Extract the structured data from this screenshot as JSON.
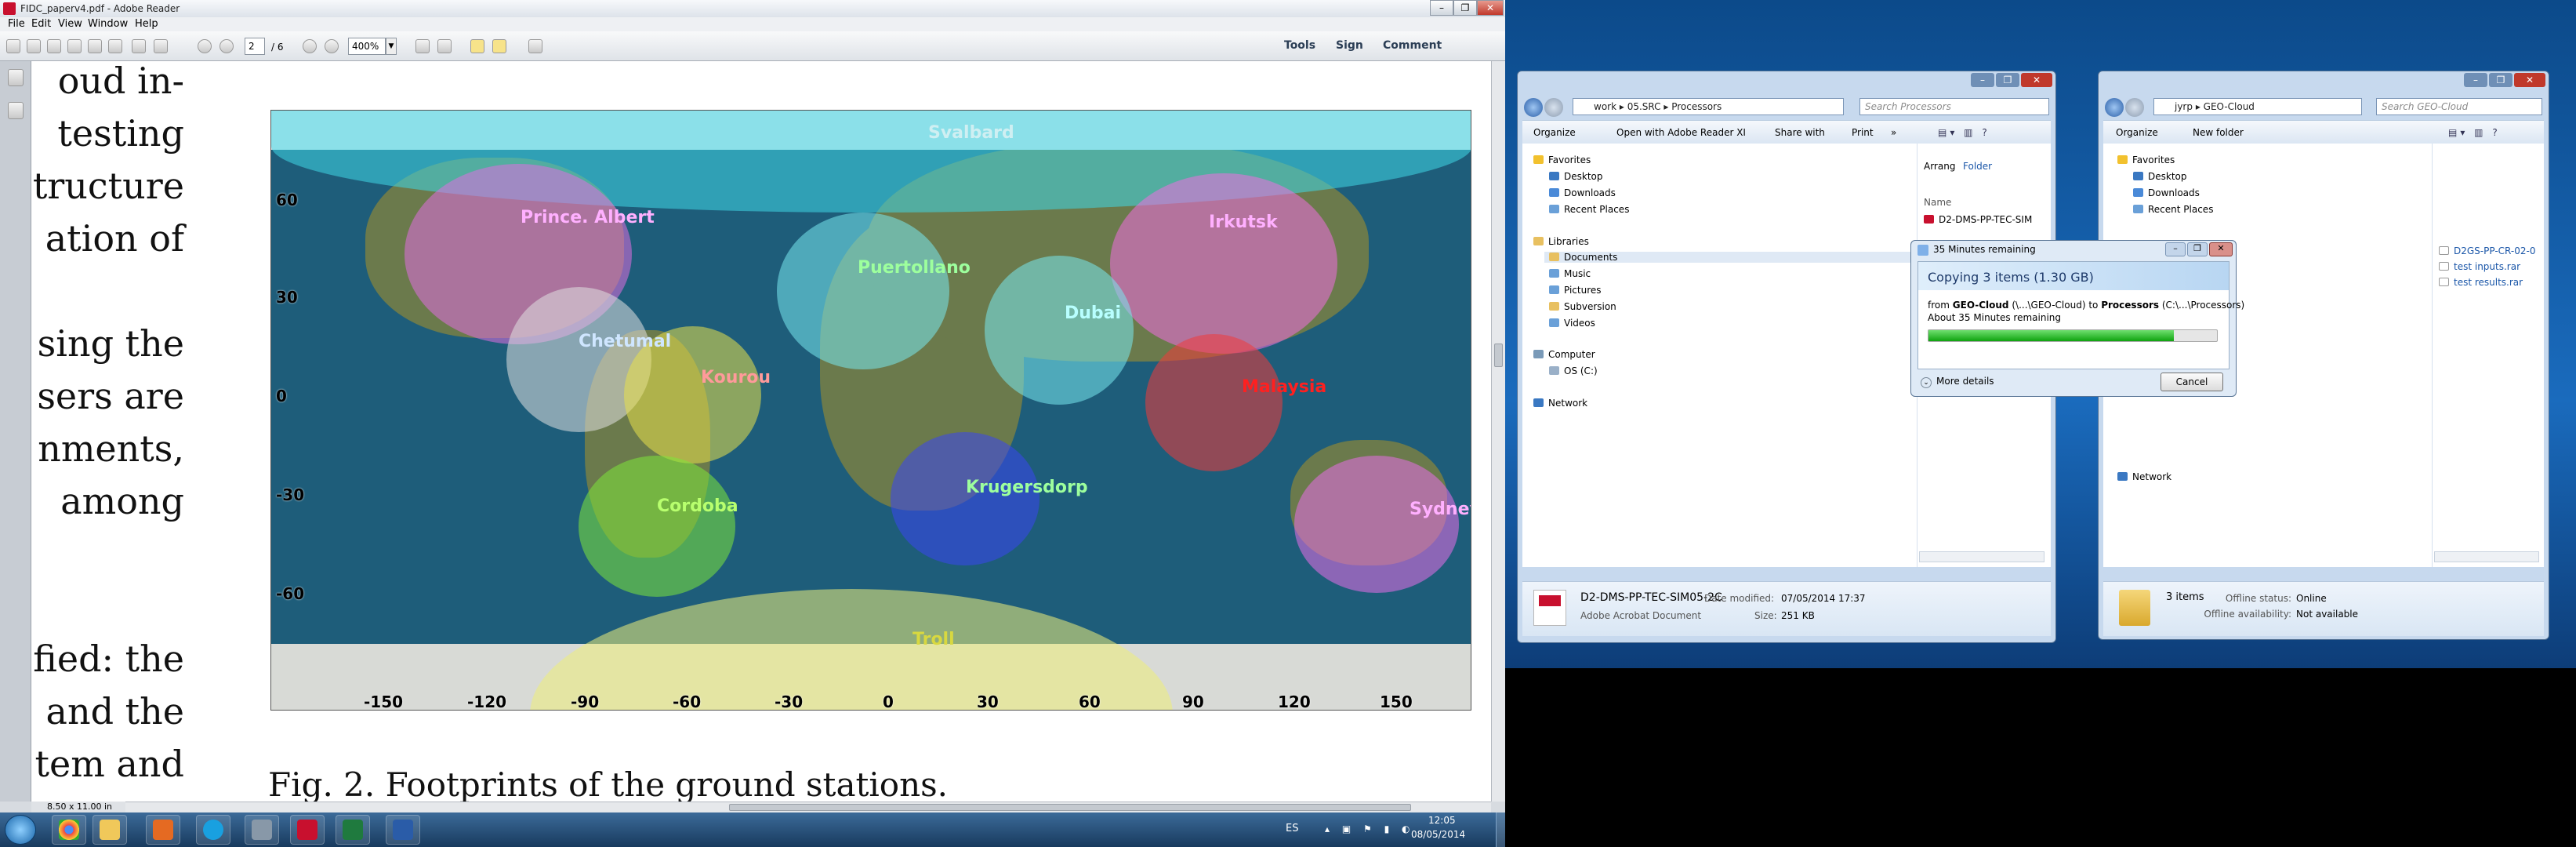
{
  "reader": {
    "title": "FIDC_paperv4.pdf - Adobe Reader",
    "menu": [
      "File",
      "Edit",
      "View",
      "Window",
      "Help"
    ],
    "page_current": "2",
    "page_total": "/ 6",
    "zoom": "400%",
    "tools_label": "Tools",
    "sign_label": "Sign",
    "comment_label": "Comment",
    "status_dims": "8.50 x 11.00 in",
    "left_text_lines": [
      "oud in-",
      "testing",
      "tructure",
      "ation of",
      "",
      "sing the",
      "sers are",
      "nments,",
      "among",
      "",
      "fied: the",
      "and the",
      "tem and"
    ],
    "figure": {
      "stations": [
        "Svalbard",
        "Prince. Albert",
        "Irkutsk",
        "Puertollano",
        "Dubai",
        "Chetumal",
        "Kourou",
        "Malaysia",
        "Cordoba",
        "Krugersdorp",
        "Sydney",
        "Troll"
      ],
      "x_ticks": [
        "-150",
        "-120",
        "-90",
        "-60",
        "-30",
        "0",
        "30",
        "60",
        "90",
        "120",
        "150"
      ],
      "y_ticks": [
        "60",
        "30",
        "0",
        "-30",
        "-60"
      ],
      "colors": {
        "ocean": "#1e5d7a",
        "land": "#6b7a4c",
        "svalbard": "#3fd7e6",
        "prince_albert": "#e06ee0",
        "irkutsk": "#f06ee0",
        "puertollano": "#79e8ee",
        "dubai": "#79e8ee",
        "chetumal": "#e0e0e0",
        "kourou": "#e8e04a",
        "malaysia": "#f03a3a",
        "cordoba": "#7ee63a",
        "krugersdorp": "#3a45f0",
        "sydney": "#e86ee8",
        "troll": "#eeee7a"
      }
    },
    "caption": "Fig. 2.   Footprints of the ground stations."
  },
  "taskbar": {
    "language": "ES",
    "time": "12:05",
    "date": "08/05/2014"
  },
  "explorer1": {
    "address": [
      "work",
      "05.SRC",
      "Processors"
    ],
    "search_placeholder": "Search Processors",
    "commands": [
      "Organize",
      "Open with Adobe Reader XI",
      "Share with",
      "Print",
      "»"
    ],
    "nav": {
      "favorites": "Favorites",
      "favorites_items": [
        "Desktop",
        "Downloads",
        "Recent Places"
      ],
      "libraries": "Libraries",
      "libraries_items": [
        "Documents",
        "Music",
        "Pictures",
        "Subversion",
        "Videos"
      ],
      "computer": "Computer",
      "computer_items": [
        "OS (C:)"
      ],
      "network": "Network"
    },
    "arrange_label": "Arrang",
    "arrange_value": "Folder",
    "column_name": "Name",
    "file_item": "D2-DMS-PP-TEC-SIM",
    "details": {
      "name": "D2-DMS-PP-TEC-SIM05-2C",
      "type": "Adobe Acrobat Document",
      "modified_label": "Date modified:",
      "modified_value": "07/05/2014 17:37",
      "size_label": "Size:",
      "size_value": "251 KB"
    }
  },
  "explorer2": {
    "address": [
      "jyrp",
      "GEO-Cloud"
    ],
    "search_placeholder": "Search GEO-Cloud",
    "commands": [
      "Organize",
      "New folder"
    ],
    "nav": {
      "favorites": "Favorites",
      "favorites_items": [
        "Desktop",
        "Downloads",
        "Recent Places"
      ],
      "network": "Network"
    },
    "files": [
      "D2GS-PP-CR-02-0",
      "test inputs.rar",
      "test results.rar"
    ],
    "details": {
      "count": "3 items",
      "offline_label": "Offline status:",
      "offline_value": "Online",
      "availability_label": "Offline availability:",
      "availability_value": "Not available"
    }
  },
  "copy_dialog": {
    "title": "35 Minutes remaining",
    "heading": "Copying 3 items (1.30 GB)",
    "from_prefix": "from",
    "from_name": "GEO-Cloud",
    "from_path": "(\\...\\GEO-Cloud)",
    "to_prefix": "to",
    "to_name": "Processors",
    "to_path": "(C:\\...\\Processors)",
    "remaining": "About 35 Minutes remaining",
    "progress": 0.85,
    "more_details": "More details",
    "cancel": "Cancel"
  }
}
